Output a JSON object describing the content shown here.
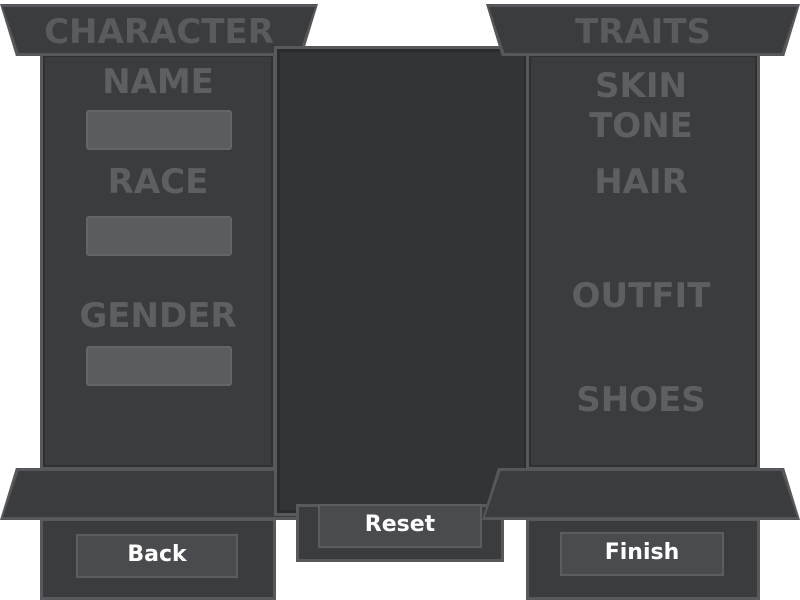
{
  "left_panel": {
    "title": "CHARACTER",
    "fields": [
      {
        "label": "NAME",
        "value": ""
      },
      {
        "label": "RACE",
        "value": ""
      },
      {
        "label": "GENDER",
        "value": ""
      }
    ]
  },
  "right_panel": {
    "title": "TRAITS",
    "items": [
      "SKIN TONE",
      "HAIR",
      "OUTFIT",
      "SHOES"
    ]
  },
  "buttons": {
    "back": "Back",
    "reset": "Reset",
    "finish": "Finish"
  },
  "colors": {
    "panel": "#3b3c3e",
    "border": "#58595c",
    "field": "#5a5c5f",
    "label_text": "#5e5f62",
    "button_text": "#ffffff"
  }
}
